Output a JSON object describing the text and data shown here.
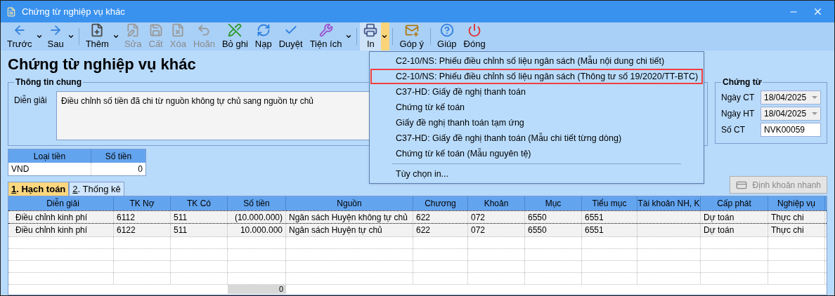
{
  "window": {
    "title": "Chứng từ nghiệp vụ khác"
  },
  "toolbar": [
    {
      "label": "Trước",
      "kind": "left",
      "disabled": false,
      "dropdown": true,
      "active": false
    },
    {
      "label": "Sau",
      "kind": "right",
      "disabled": false,
      "dropdown": true,
      "active": false
    },
    {
      "label": "Thêm",
      "kind": "new",
      "disabled": false,
      "dropdown": true,
      "active": false
    },
    {
      "label": "Sửa",
      "kind": "edit",
      "disabled": true,
      "dropdown": false,
      "active": false
    },
    {
      "label": "Cất",
      "kind": "save",
      "disabled": true,
      "dropdown": false,
      "active": false
    },
    {
      "label": "Xóa",
      "kind": "delete",
      "disabled": true,
      "dropdown": false,
      "active": false
    },
    {
      "label": "Hoãn",
      "kind": "undo",
      "disabled": true,
      "dropdown": false,
      "active": false
    },
    {
      "label": "Bỏ ghi",
      "kind": "unpost",
      "disabled": false,
      "dropdown": false,
      "active": false
    },
    {
      "label": "Nạp",
      "kind": "reload",
      "disabled": false,
      "dropdown": false,
      "active": false
    },
    {
      "label": "Duyệt",
      "kind": "check",
      "disabled": false,
      "dropdown": false,
      "active": false
    },
    {
      "label": "Tiện ích",
      "kind": "tools",
      "disabled": false,
      "dropdown": true,
      "active": false
    },
    {
      "label": "In",
      "kind": "print",
      "disabled": false,
      "dropdown": true,
      "active": true
    },
    {
      "label": "Góp ý",
      "kind": "feedback",
      "disabled": false,
      "dropdown": false,
      "active": false
    },
    {
      "label": "Giúp",
      "kind": "help",
      "disabled": false,
      "dropdown": false,
      "active": false
    },
    {
      "label": "Đóng",
      "kind": "power",
      "disabled": false,
      "dropdown": false,
      "active": false
    }
  ],
  "print_menu": {
    "items": [
      {
        "kind": "item",
        "label": "C2-10/NS: Phiếu điều chỉnh số liệu ngân sách (Mẫu nội dung chi tiết)",
        "highlighted": false
      },
      {
        "kind": "item",
        "label": "C2-10/NS: Phiếu điều chỉnh số liệu ngân sách (Thông tư số 19/2020/TT-BTC)",
        "highlighted": true
      },
      {
        "kind": "item",
        "label": "C37-HD: Giấy đề nghị thanh toán",
        "highlighted": false
      },
      {
        "kind": "item",
        "label": "Chứng từ kế toán",
        "highlighted": false
      },
      {
        "kind": "item",
        "label": "Giấy đề nghị thanh toán tạm ứng",
        "highlighted": false
      },
      {
        "kind": "item",
        "label": "C37-HD: Giấy đề nghị thanh toán (Mẫu chi tiết từng dòng)",
        "highlighted": false
      },
      {
        "kind": "item",
        "label": "Chứng từ kế toán (Mẫu nguyên tệ)",
        "highlighted": false
      },
      {
        "kind": "separator"
      },
      {
        "kind": "item",
        "label": "Tùy chọn in...",
        "highlighted": false
      }
    ]
  },
  "heading": "Chứng từ nghiệp vụ khác",
  "general_info": {
    "legend": "Thông tin chung",
    "description_label": "Diễn giải",
    "description": "Điều chỉnh số tiền đã chi từ nguồn không tự chủ sang nguồn tự chủ"
  },
  "voucher": {
    "legend": "Chứng từ",
    "fields": [
      {
        "label": "Ngày CT",
        "value": "18/04/2025",
        "kind": "date"
      },
      {
        "label": "Ngày HT",
        "value": "18/04/2025",
        "kind": "date"
      },
      {
        "label": "Số CT",
        "value": "NVK00059",
        "kind": "text"
      }
    ]
  },
  "currency_table": {
    "columns": [
      "Loại tiền",
      "Số tiền"
    ],
    "rows": [
      [
        "VND",
        "0"
      ]
    ]
  },
  "tabs": [
    {
      "hotkey": "1",
      "label": ". Hạch toán",
      "selected": true
    },
    {
      "hotkey": "2",
      "label": ". Thống kê",
      "selected": false
    }
  ],
  "quick_entry_button": {
    "label": "Định khoản nhanh",
    "disabled": true
  },
  "entries_table": {
    "columns": [
      "Diễn giải",
      "TK Nợ",
      "TK Có",
      "Số tiền",
      "Nguồn",
      "Chương",
      "Khoản",
      "Mục",
      "Tiểu mục",
      "Tài khoản NH, K",
      "Cấp phát",
      "Nghiệp vụ"
    ],
    "rows": [
      [
        "Điều chỉnh kinh phí",
        "6112",
        "511",
        "(10.000.000)",
        "Ngân sách Huyện không tự chủ",
        "622",
        "072",
        "6550",
        "6551",
        "",
        "Dự toán",
        "Thực chi"
      ],
      [
        "Điều chỉnh kinh phí",
        "6122",
        "511",
        "10.000.000",
        "Ngân sách Huyện tự chủ",
        "622",
        "072",
        "6550",
        "6551",
        "",
        "Dự toán",
        "Thực chi"
      ]
    ],
    "total": "0"
  }
}
